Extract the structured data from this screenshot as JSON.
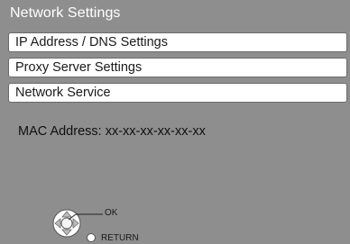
{
  "colors": {
    "background": "#8e8e8e",
    "menu_item_background": "#ffffff",
    "title_text": "#ffffff",
    "body_text": "#101010"
  },
  "screen": {
    "title": "Network Settings"
  },
  "menu": {
    "items": [
      {
        "label": "IP Address / DNS Settings"
      },
      {
        "label": "Proxy Server Settings"
      },
      {
        "label": "Network Service"
      }
    ]
  },
  "info": {
    "mac_address_text": "MAC Address: xx-xx-xx-xx-xx-xx"
  },
  "controls": {
    "ok_label": "OK",
    "return_label": "RETURN",
    "dpad_icon": "dpad-icon",
    "return_icon": "return-circle-icon"
  }
}
